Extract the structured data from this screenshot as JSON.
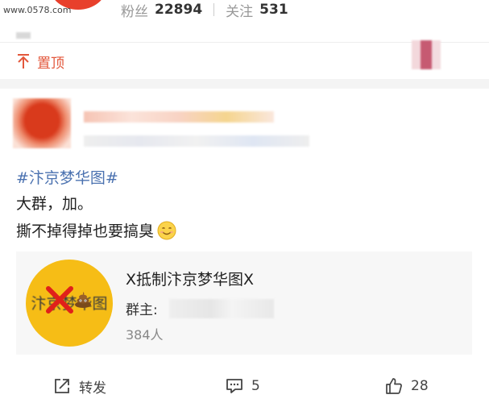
{
  "watermark": "www.0578.com",
  "profile": {
    "fans_label": "粉丝",
    "fans_count": "22894",
    "follow_label": "关注",
    "follow_count": "531"
  },
  "pinned": {
    "icon": "pin-top-icon",
    "label": "置顶"
  },
  "post": {
    "hashtag": "#汴京梦华图#",
    "lines": [
      "大群，加。",
      "撕不掉得掉也要搞臭"
    ],
    "emoji": "smile-emoji"
  },
  "group_card": {
    "logo_text": "汴京梦华图",
    "name": "X抵制汴京梦华图X",
    "owner_label": "群主:",
    "members": "384人"
  },
  "actions": {
    "share_label": "转发",
    "comment_count": "5",
    "like_count": "28"
  },
  "colors": {
    "accent": "#e3573b",
    "link": "#4b72b0",
    "logo_bg": "#f6bd16"
  }
}
